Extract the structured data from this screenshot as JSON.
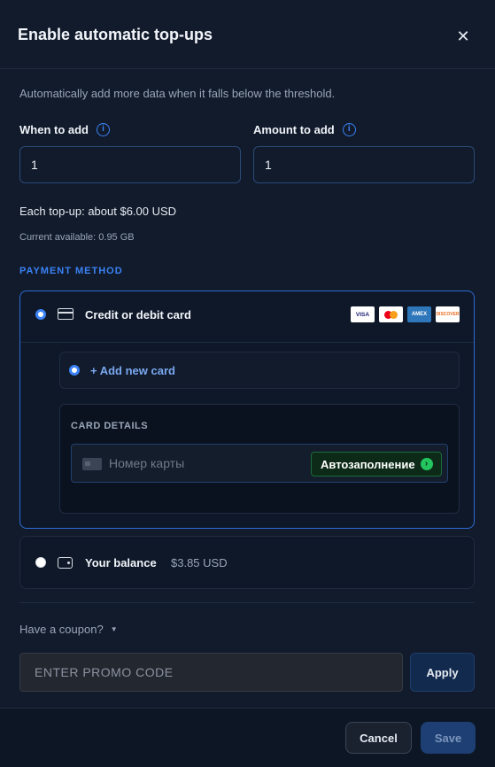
{
  "modal": {
    "title": "Enable automatic top-ups",
    "close_icon": "close-icon",
    "description": "Automatically add more data when it falls below the threshold."
  },
  "when_to_add": {
    "label": "When to add",
    "value": "1",
    "info_icon": "info-icon"
  },
  "amount_to_add": {
    "label": "Amount to add",
    "value": "1",
    "info_icon": "info-icon"
  },
  "summary": {
    "each_topup": "Each top-up: about $6.00 USD",
    "current_available": "Current available: 0.95 GB"
  },
  "payment": {
    "section_title": "PAYMENT METHOD",
    "card_option": {
      "label": "Credit or debit card",
      "selected": true,
      "logos": [
        "VISA",
        "MASTERCARD",
        "AMEX",
        "DISCOVER"
      ]
    },
    "add_new_card": {
      "label": "+ Add new card",
      "selected": true
    },
    "card_details": {
      "title": "CARD DETAILS",
      "number_placeholder": "Номер карты",
      "autofill_label": "Автозаполнение"
    },
    "balance_option": {
      "label": "Your balance",
      "amount": "$3.85 USD",
      "selected": false
    }
  },
  "coupon": {
    "toggle_label": "Have a coupon?",
    "placeholder": "ENTER PROMO CODE",
    "apply_label": "Apply"
  },
  "footer": {
    "cancel_label": "Cancel",
    "save_label": "Save"
  },
  "colors": {
    "accent": "#3b82f6",
    "background": "#111b2b",
    "autofill_green": "#22c55e"
  }
}
